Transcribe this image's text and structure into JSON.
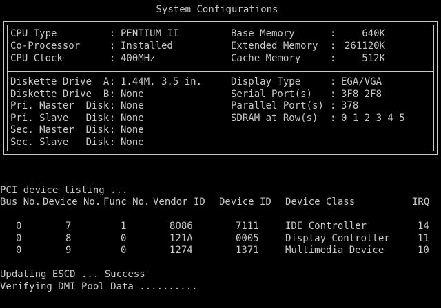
{
  "title": "System Configurations",
  "config": {
    "left_top": [
      {
        "label": "CPU Type",
        "value": "PENTIUM II"
      },
      {
        "label": "Co-Processor",
        "value": "Installed"
      },
      {
        "label": "CPU Clock",
        "value": "400MHz"
      }
    ],
    "right_top": [
      {
        "label": "Base Memory",
        "value": "640K"
      },
      {
        "label": "Extended Memory",
        "value": "261120K"
      },
      {
        "label": "Cache Memory",
        "value": "512K"
      }
    ],
    "left_bottom": [
      {
        "label": "Diskette Drive  A",
        "value": "1.44M, 3.5 in."
      },
      {
        "label": "Diskette Drive  B",
        "value": "None"
      },
      {
        "label": "Pri. Master  Disk",
        "value": "None"
      },
      {
        "label": "Pri. Slave   Disk",
        "value": "None"
      },
      {
        "label": "Sec. Master  Disk",
        "value": "None"
      },
      {
        "label": "Sec. Slave   Disk",
        "value": "None"
      }
    ],
    "right_bottom": [
      {
        "label": "Display Type",
        "value": "EGA/VGA"
      },
      {
        "label": "Serial Port(s)",
        "value": "3F8 2F8"
      },
      {
        "label": "Parallel Port(s)",
        "value": "378"
      },
      {
        "label": "SDRAM at Row(s)",
        "value": "0 1 2 3 4 5"
      }
    ]
  },
  "pci": {
    "heading": "PCI device listing ...",
    "headers": [
      "Bus No.",
      "Device No.",
      "Func No.",
      "Vendor ID",
      "Device ID",
      "Device Class",
      "IRQ"
    ],
    "rows": [
      [
        "0",
        "7",
        "1",
        "8086",
        "7111",
        "IDE Controller",
        "14"
      ],
      [
        "0",
        "8",
        "0",
        "121A",
        "0005",
        "Display Controller",
        "11"
      ],
      [
        "0",
        "9",
        "0",
        "1274",
        "1371",
        "Multimedia Device",
        "10"
      ]
    ]
  },
  "status": {
    "line1": "Updating ESCD ... Success",
    "line2": "Verifying DMI Pool Data .........."
  }
}
